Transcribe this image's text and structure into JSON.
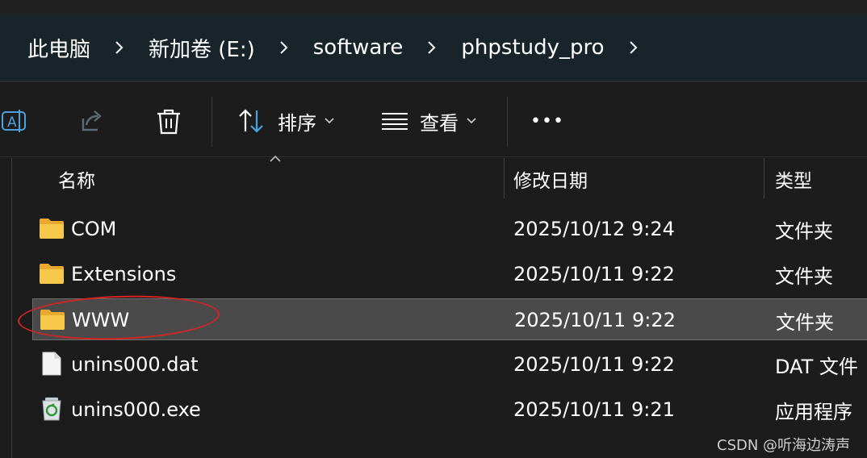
{
  "breadcrumb": {
    "items": [
      "此电脑",
      "新加卷 (E:)",
      "software",
      "phpstudy_pro"
    ]
  },
  "toolbar": {
    "sort_label": "排序",
    "view_label": "查看",
    "more_label": "•••"
  },
  "columns": {
    "name": "名称",
    "modified": "修改日期",
    "type": "类型"
  },
  "files": [
    {
      "name": "COM",
      "modified": "2025/10/12 9:24",
      "type": "文件夹",
      "icon": "folder-icon"
    },
    {
      "name": "Extensions",
      "modified": "2025/10/11 9:22",
      "type": "文件夹",
      "icon": "folder-icon"
    },
    {
      "name": "WWW",
      "modified": "2025/10/11 9:22",
      "type": "文件夹",
      "icon": "folder-icon",
      "selected": true
    },
    {
      "name": "unins000.dat",
      "modified": "2025/10/11 9:22",
      "type": "DAT 文件",
      "icon": "file-icon"
    },
    {
      "name": "unins000.exe",
      "modified": "2025/10/11 9:21",
      "type": "应用程序",
      "icon": "recycle-app-icon"
    }
  ],
  "watermark": "CSDN @听海边涛声",
  "colors": {
    "address_bg": "#19232a",
    "selection_bg": "#4a4a4a",
    "folder_yellow": "#f7c84a",
    "annotation_red": "#d42424"
  }
}
